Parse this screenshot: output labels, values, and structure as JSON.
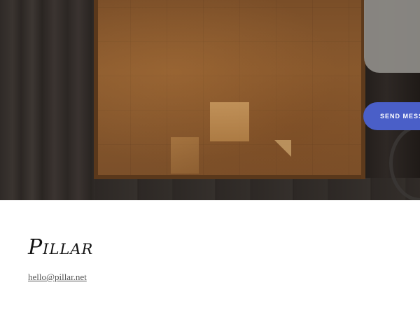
{
  "hero": {
    "send_button_label": "SEND MESSA"
  },
  "footer": {
    "logo_text": "Pillar",
    "email": "hello@pillar.net"
  },
  "colors": {
    "accent": "#4a5fc8",
    "text": "#111111",
    "link": "#555555"
  }
}
